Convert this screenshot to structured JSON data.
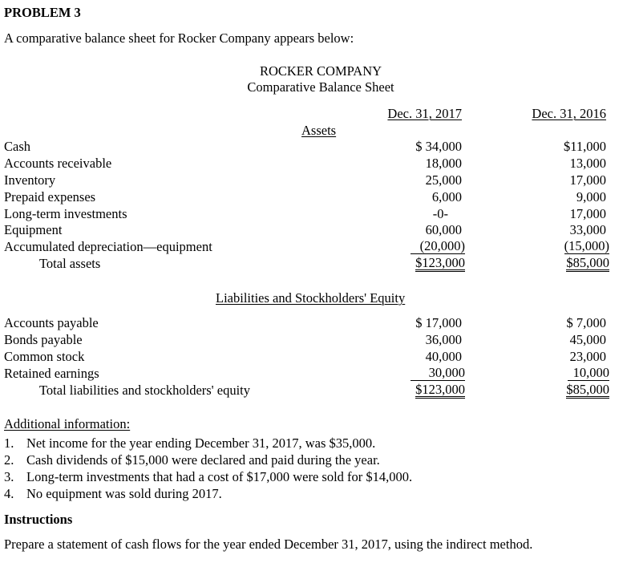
{
  "problem": {
    "title": "PROBLEM 3",
    "intro": "A comparative balance sheet for Rocker Company appears below:"
  },
  "statement": {
    "company": "ROCKER COMPANY",
    "name": "Comparative Balance Sheet",
    "col_headers": [
      "Dec. 31, 2017",
      "Dec. 31, 2016"
    ],
    "assets": {
      "heading": "Assets",
      "rows": [
        {
          "label": "Cash",
          "y2017": "$ 34,000",
          "y2016": "$11,000"
        },
        {
          "label": "Accounts receivable",
          "y2017": "18,000",
          "y2016": "13,000"
        },
        {
          "label": "Inventory",
          "y2017": "25,000",
          "y2016": "17,000"
        },
        {
          "label": "Prepaid expenses",
          "y2017": "6,000",
          "y2016": "9,000"
        },
        {
          "label": "Long-term investments",
          "y2017": "-0-",
          "y2016": "17,000"
        },
        {
          "label": "Equipment",
          "y2017": "60,000",
          "y2016": "33,000"
        },
        {
          "label": "Accumulated depreciation—equipment",
          "y2017": "(20,000)",
          "y2016": "(15,000)"
        }
      ],
      "total": {
        "label": "Total assets",
        "y2017": "$123,000",
        "y2016": "$85,000"
      }
    },
    "liabilities": {
      "heading": "Liabilities and Stockholders' Equity",
      "rows": [
        {
          "label": "Accounts payable",
          "y2017": "$ 17,000",
          "y2016": "$ 7,000"
        },
        {
          "label": "Bonds payable",
          "y2017": "36,000",
          "y2016": "45,000"
        },
        {
          "label": "Common stock",
          "y2017": "40,000",
          "y2016": "23,000"
        },
        {
          "label": "Retained earnings",
          "y2017": "30,000",
          "y2016": "10,000"
        }
      ],
      "total": {
        "label": "Total liabilities and stockholders' equity",
        "y2017": "$123,000",
        "y2016": "$85,000"
      }
    }
  },
  "additional": {
    "heading": "Additional information:",
    "items": [
      {
        "num": "1.",
        "text": "Net income for the year ending December 31, 2017, was $35,000."
      },
      {
        "num": "2.",
        "text": "Cash dividends of $15,000 were declared and paid during the year."
      },
      {
        "num": "3.",
        "text": "Long-term investments that had a cost of $17,000 were sold for $14,000."
      },
      {
        "num": "4.",
        "text": "No equipment was sold during 2017."
      }
    ]
  },
  "instructions": {
    "heading": "Instructions",
    "text": "Prepare a statement of cash flows for the year ended December 31, 2017, using the indirect method."
  }
}
